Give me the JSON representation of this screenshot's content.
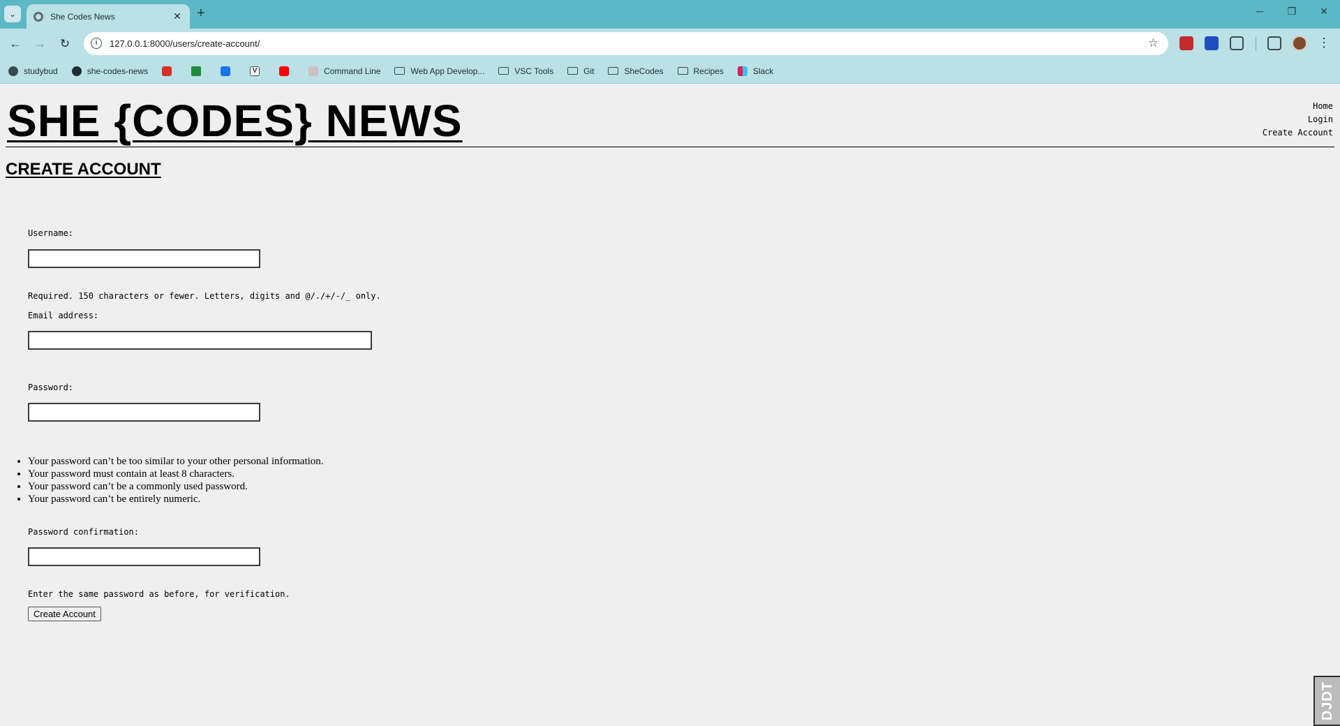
{
  "browser": {
    "tab_title": "She Codes News",
    "url": "127.0.0.1:8000/users/create-account/",
    "bookmarks": [
      {
        "label": "studybud",
        "icon": "globe-icon"
      },
      {
        "label": "she-codes-news",
        "icon": "globe-icon"
      },
      {
        "label": "",
        "icon": "gmail-icon",
        "color": "#d93025"
      },
      {
        "label": "",
        "icon": "drive-icon",
        "color": "#1e8e3e"
      },
      {
        "label": "",
        "icon": "calendar-icon",
        "color": "#1a73e8"
      },
      {
        "label": "",
        "icon": "v-icon",
        "color": "#1f2d30"
      },
      {
        "label": "",
        "icon": "youtube-icon",
        "color": "#ff0000"
      },
      {
        "label": "Command Line",
        "icon": "page-icon"
      },
      {
        "label": "Web App Develop...",
        "icon": "folder-icon"
      },
      {
        "label": "VSC Tools",
        "icon": "folder-icon"
      },
      {
        "label": "Git",
        "icon": "folder-icon"
      },
      {
        "label": "SheCodes",
        "icon": "folder-icon"
      },
      {
        "label": "Recipes",
        "icon": "folder-icon"
      },
      {
        "label": "Slack",
        "icon": "slack-icon"
      }
    ]
  },
  "site": {
    "title": "SHE {CODES} NEWS",
    "nav": [
      "Home",
      "Login",
      "Create Account"
    ]
  },
  "page": {
    "heading": "CREATE ACCOUNT"
  },
  "form": {
    "username_label": "Username:",
    "username_value": "",
    "username_help": "Required. 150 characters or fewer. Letters, digits and @/./+/-/_ only.",
    "email_label": "Email address:",
    "email_value": "",
    "password_label": "Password:",
    "password_value": "",
    "password_rules": [
      "Your password can’t be too similar to your other personal information.",
      "Your password must contain at least 8 characters.",
      "Your password can’t be a commonly used password.",
      "Your password can’t be entirely numeric."
    ],
    "confirm_label": "Password confirmation:",
    "confirm_value": "",
    "confirm_help": "Enter the same password as before, for verification.",
    "submit_label": "Create Account"
  },
  "debug_toolbar": {
    "label": "DJDT"
  }
}
